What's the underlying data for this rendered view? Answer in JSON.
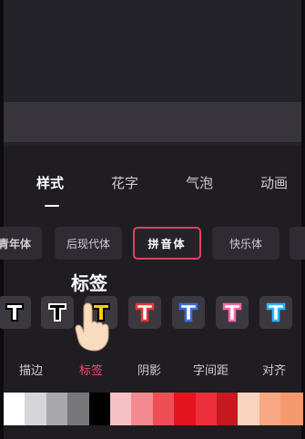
{
  "tabs": [
    {
      "label": "样式",
      "active": true
    },
    {
      "label": "花字",
      "active": false
    },
    {
      "label": "气泡",
      "active": false
    },
    {
      "label": "动画",
      "active": false
    }
  ],
  "fonts": [
    {
      "label": "青年体",
      "selected": false
    },
    {
      "label": "后现代体",
      "selected": false
    },
    {
      "label": "拼音体",
      "selected": true
    },
    {
      "label": "快乐体",
      "selected": false
    }
  ],
  "tooltip": "标签",
  "style_chips": [
    {
      "glyph": "T",
      "fill": "#ffffff",
      "stroke": "#000000"
    },
    {
      "glyph": "T",
      "fill": "#000000",
      "stroke": "#ffffff"
    },
    {
      "glyph": "T",
      "fill": "#f5d000",
      "stroke": "#000000"
    },
    {
      "glyph": "T",
      "fill": "#ffffff",
      "stroke": "#e03a3a"
    },
    {
      "glyph": "T",
      "fill": "#ffffff",
      "stroke": "#3a6fd8"
    },
    {
      "glyph": "T",
      "fill": "#ffffff",
      "stroke": "#f06aa8"
    },
    {
      "glyph": "T",
      "fill": "#ffffff",
      "stroke": "#2fb3ff"
    }
  ],
  "sub_tabs": [
    {
      "label": "描边",
      "active": false
    },
    {
      "label": "标签",
      "active": true
    },
    {
      "label": "阴影",
      "active": false
    },
    {
      "label": "字间距",
      "active": false
    },
    {
      "label": "对齐",
      "active": false
    }
  ],
  "swatches": [
    "#ffffff",
    "#d6d6d8",
    "#a8a8ab",
    "#77777a",
    "#000000",
    "#f6c0c4",
    "#f38a8f",
    "#ee4e55",
    "#e4141f",
    "#ec2f3a",
    "#c71920",
    "#f9d3bf",
    "#f7a783",
    "#f49a6e"
  ]
}
